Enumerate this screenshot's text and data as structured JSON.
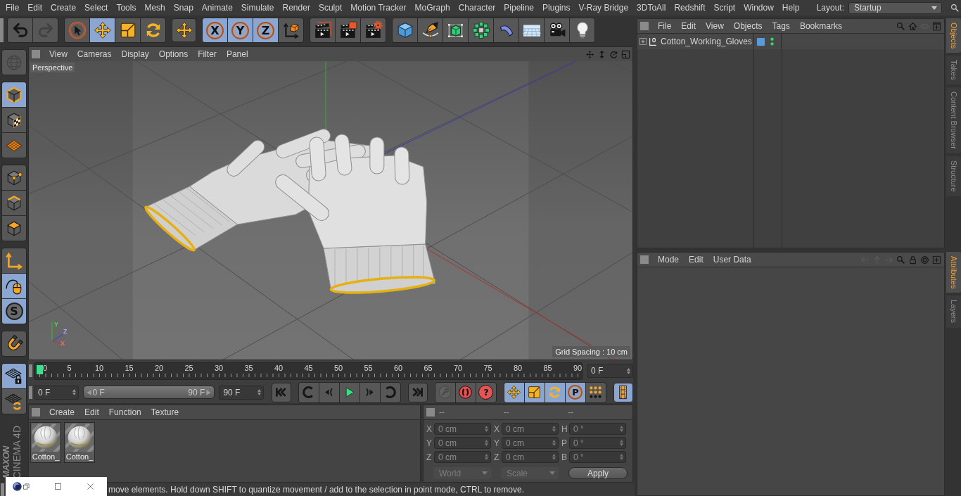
{
  "menubar": {
    "items": [
      "File",
      "Edit",
      "Create",
      "Select",
      "Tools",
      "Mesh",
      "Snap",
      "Animate",
      "Simulate",
      "Render",
      "Sculpt",
      "Motion Tracker",
      "MoGraph",
      "Character",
      "Pipeline",
      "Plugins",
      "V-Ray Bridge",
      "3DToAll",
      "Redshift",
      "Script",
      "Window",
      "Help"
    ],
    "layout_label": "Layout:",
    "layout_value": "Startup"
  },
  "toolbar": [
    [
      {
        "kind": "undo",
        "selected": false,
        "disabled": false
      },
      {
        "kind": "redo",
        "selected": false,
        "disabled": true
      }
    ],
    [
      {
        "kind": "live-selection",
        "selected": false,
        "disabled": false
      },
      {
        "kind": "move",
        "selected": true,
        "disabled": false
      },
      {
        "kind": "scale",
        "selected": false,
        "disabled": false
      },
      {
        "kind": "rotate",
        "selected": false,
        "disabled": false
      }
    ],
    [
      {
        "kind": "move",
        "selected": false,
        "disabled": false
      }
    ],
    [
      {
        "kind": "axis-lock",
        "label": "X",
        "selected": true,
        "disabled": false
      },
      {
        "kind": "axis-lock",
        "label": "Y",
        "selected": true,
        "disabled": false
      },
      {
        "kind": "axis-lock",
        "label": "Z",
        "selected": true,
        "disabled": false
      },
      {
        "kind": "coordinate-system",
        "selected": false,
        "disabled": false
      }
    ],
    [
      {
        "kind": "render-view",
        "selected": false,
        "disabled": false
      },
      {
        "kind": "render-picture-viewer",
        "selected": false,
        "disabled": false
      },
      {
        "kind": "render-settings",
        "selected": false,
        "disabled": false
      }
    ],
    [
      {
        "kind": "cube",
        "selected": false,
        "disabled": false
      },
      {
        "kind": "pen",
        "selected": false,
        "disabled": false
      },
      {
        "kind": "subdivision",
        "selected": false,
        "disabled": false
      },
      {
        "kind": "cloner",
        "selected": false,
        "disabled": false
      },
      {
        "kind": "bend",
        "selected": false,
        "disabled": false
      },
      {
        "kind": "floor",
        "selected": false,
        "disabled": false
      },
      {
        "kind": "camera",
        "selected": false,
        "disabled": false
      },
      {
        "kind": "light",
        "selected": false,
        "disabled": false
      }
    ]
  ],
  "left_toolbar": [
    [
      {
        "kind": "make-editable",
        "selected": false,
        "disabled": true
      }
    ],
    [
      {
        "kind": "model-mode",
        "selected": true,
        "disabled": false
      },
      {
        "kind": "texture-mode",
        "selected": false,
        "disabled": false
      },
      {
        "kind": "workplane-mode",
        "selected": false,
        "disabled": false
      }
    ],
    [
      {
        "kind": "points-mode",
        "selected": false,
        "disabled": false
      },
      {
        "kind": "edges-mode",
        "selected": false,
        "disabled": false
      },
      {
        "kind": "polygons-mode",
        "selected": false,
        "disabled": false
      }
    ],
    [
      {
        "kind": "axis-mode",
        "selected": false,
        "disabled": false
      },
      {
        "kind": "tweak-mode",
        "selected": true,
        "disabled": false
      },
      {
        "kind": "solo",
        "label": "S",
        "selected": true,
        "disabled": false
      }
    ],
    [
      {
        "kind": "snap",
        "selected": false,
        "disabled": false
      }
    ],
    [
      {
        "kind": "workplane-lock",
        "selected": true,
        "disabled": false
      },
      {
        "kind": "workplane-align",
        "selected": false,
        "disabled": false
      }
    ]
  ],
  "logo": {
    "brand": "MAXON",
    "product": "CINEMA 4D"
  },
  "viewport": {
    "menu": [
      "View",
      "Cameras",
      "Display",
      "Options",
      "Filter",
      "Panel"
    ],
    "camera": "Perspective",
    "grid_spacing": "Grid Spacing : 10 cm",
    "axes": [
      "Y",
      "Z",
      "X"
    ]
  },
  "timeline": {
    "ticks": [
      "0",
      "5",
      "10",
      "15",
      "20",
      "25",
      "30",
      "35",
      "40",
      "45",
      "50",
      "55",
      "60",
      "65",
      "70",
      "75",
      "80",
      "85",
      "90"
    ],
    "playhead": {
      "level": 0
    },
    "current_frame": "0 F"
  },
  "transport": {
    "start": "0 F",
    "range": {
      "start": "0 F",
      "end": "90 F",
      "level": 1
    },
    "end": "90 F",
    "buttons": [
      [
        {
          "kind": "go-start",
          "selected": false,
          "disabled": false
        }
      ],
      [
        {
          "kind": "previous-key",
          "selected": false,
          "disabled": false
        },
        {
          "kind": "previous-frame",
          "selected": false,
          "disabled": false
        },
        {
          "kind": "play",
          "selected": false,
          "disabled": false
        },
        {
          "kind": "next-frame",
          "selected": false,
          "disabled": false
        },
        {
          "kind": "next-key",
          "selected": false,
          "disabled": false
        }
      ],
      [
        {
          "kind": "go-end",
          "selected": false,
          "disabled": false
        }
      ],
      [
        {
          "kind": "record-key",
          "selected": false,
          "disabled": true
        },
        {
          "kind": "auto-key",
          "selected": false,
          "disabled": false
        },
        {
          "kind": "help",
          "label": "?",
          "selected": false,
          "disabled": false
        }
      ],
      [
        {
          "kind": "move",
          "selected": true,
          "disabled": false
        },
        {
          "kind": "scale",
          "selected": true,
          "disabled": false
        },
        {
          "kind": "rotate",
          "selected": true,
          "disabled": false
        },
        {
          "kind": "parameter",
          "label": "P",
          "selected": true,
          "disabled": false
        },
        {
          "kind": "point-level",
          "selected": false,
          "disabled": false
        }
      ],
      [
        {
          "kind": "timeline",
          "selected": true,
          "disabled": false
        }
      ]
    ]
  },
  "materials": {
    "menu": [
      "Create",
      "Edit",
      "Function",
      "Texture"
    ],
    "items": [
      {
        "name": "Cotton_"
      },
      {
        "name": "Cotton_"
      }
    ]
  },
  "coordinates": {
    "headers": [
      "--",
      "--",
      "--"
    ],
    "rows": [
      [
        {
          "axis": "X",
          "value": "0 cm"
        },
        {
          "axis": "X",
          "value": "0 cm"
        },
        {
          "axis": "H",
          "value": "0 °"
        }
      ],
      [
        {
          "axis": "Y",
          "value": "0 cm"
        },
        {
          "axis": "Y",
          "value": "0 cm"
        },
        {
          "axis": "P",
          "value": "0 °"
        }
      ],
      [
        {
          "axis": "Z",
          "value": "0 cm"
        },
        {
          "axis": "Z",
          "value": "0 cm"
        },
        {
          "axis": "B",
          "value": "0 °"
        }
      ]
    ],
    "dropdowns": [
      {
        "label": "World",
        "disabled": true
      },
      {
        "label": "Scale",
        "disabled": true
      }
    ],
    "apply": "Apply"
  },
  "status_bar": "move elements. Hold down SHIFT to quantize movement / add to the selection in point mode, CTRL to remove.",
  "objects_panel": {
    "menu": [
      "File",
      "Edit",
      "View",
      "Objects",
      "Tags",
      "Bookmarks"
    ],
    "objects": [
      {
        "name": "Cotton_Working_Gloves",
        "expanded": false
      }
    ]
  },
  "right_tabs_top": [
    {
      "label": "Objects",
      "selected": true
    },
    {
      "label": "Takes",
      "selected": false
    },
    {
      "label": "Content Browser",
      "selected": false
    },
    {
      "label": "Structure",
      "selected": false
    }
  ],
  "attributes_panel": {
    "menu": [
      "Mode",
      "Edit",
      "User Data"
    ]
  },
  "right_tabs_bottom": [
    {
      "label": "Attributes",
      "selected": true
    },
    {
      "label": "Layers",
      "selected": false
    }
  ]
}
